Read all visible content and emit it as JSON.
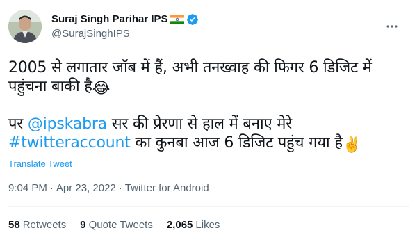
{
  "author": {
    "name": "Suraj Singh Parihar IPS",
    "handle": "@SurajSinghIPS",
    "verified": true,
    "flag_icon": "india-flag-icon",
    "verified_icon": "verified-badge-icon",
    "avatar_icon": "profile-avatar"
  },
  "tweet": {
    "line1_text": "2005 से लगातार जॉब में हैं, अभी तनख्वाह की फिगर 6 डिजिट में पहुंचना बाकी है",
    "line1_emoji": "😂",
    "line2_prefix": "पर ",
    "line2_mention": "@ipskabra",
    "line2_mid": " सर की प्रेरणा से हाल में बनाए मेरे",
    "line2_hashtag": "#twitteraccount",
    "line2_suffix": " का कुनबा आज 6 डिजिट पहुंच गया है",
    "line2_emoji": "✌️",
    "translate_label": "Translate Tweet"
  },
  "meta": {
    "time": "9:04 PM",
    "sep1": "·",
    "date": "Apr 23, 2022",
    "sep2": "·",
    "source": "Twitter for Android"
  },
  "stats": {
    "retweets_count": "58",
    "retweets_label": "Retweets",
    "quotes_count": "9",
    "quotes_label": "Quote Tweets",
    "likes_count": "2,065",
    "likes_label": "Likes"
  },
  "colors": {
    "link": "#1d9bf0",
    "text": "#0f1419",
    "muted": "#536471",
    "divider": "#eff3f4"
  }
}
